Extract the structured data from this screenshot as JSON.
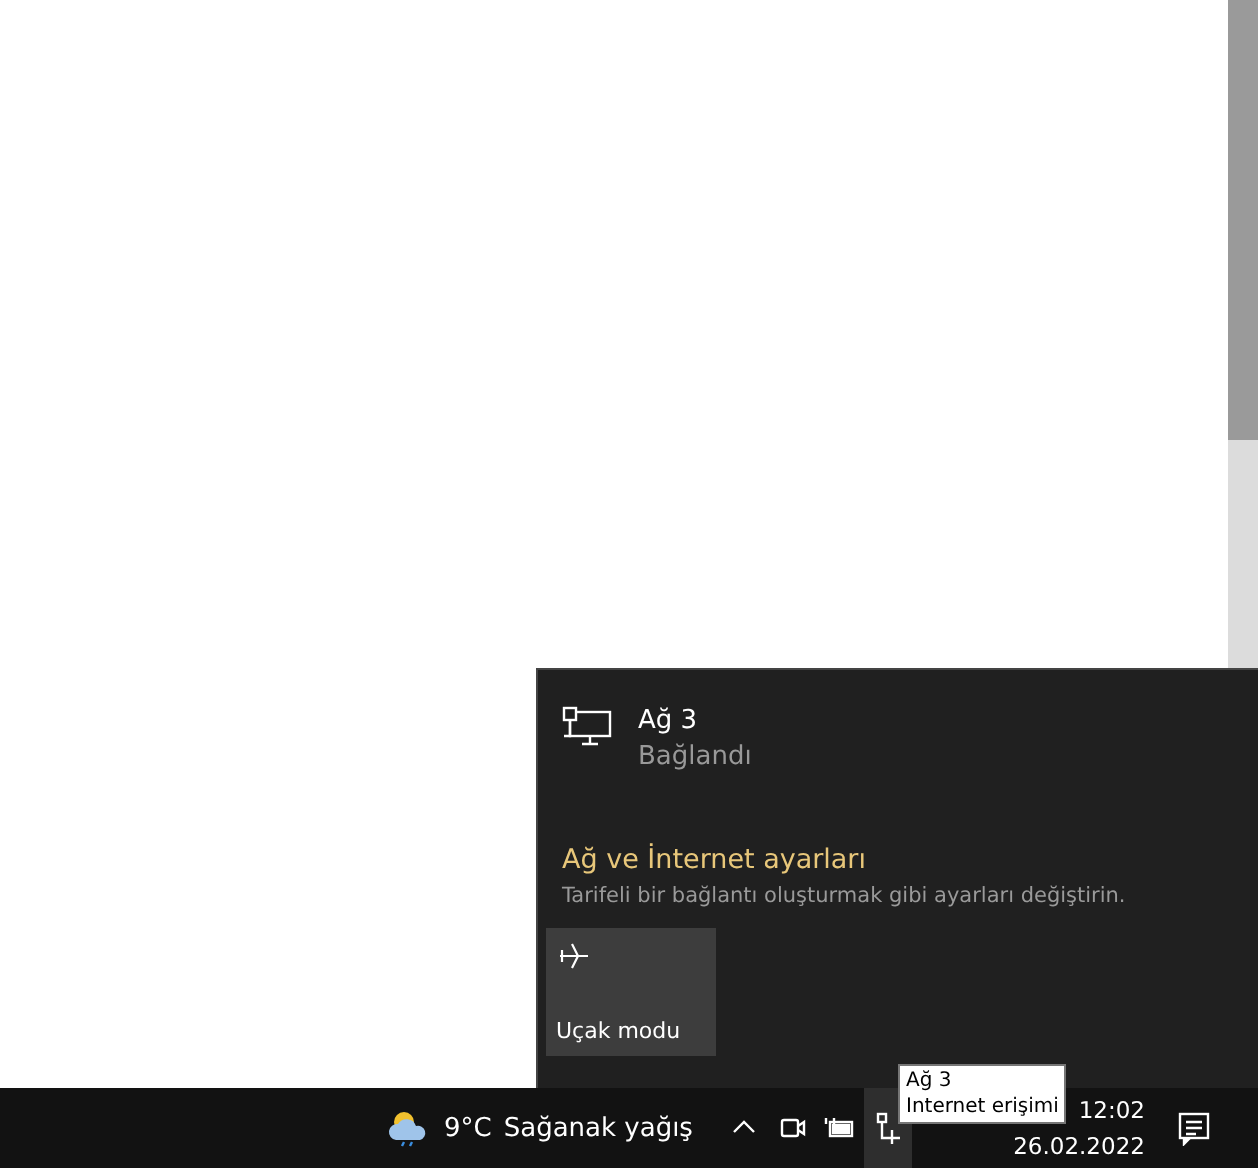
{
  "network_flyout": {
    "network": {
      "name": "Ağ 3",
      "status": "Bağlandı"
    },
    "settings_link": "Ağ ve İnternet ayarları",
    "settings_hint": "Tarifeli bir bağlantı oluşturmak gibi ayarları değiştirin.",
    "quick_actions": [
      {
        "label": "Uçak modu",
        "on": false
      }
    ]
  },
  "taskbar": {
    "weather": {
      "temperature": "9°C",
      "condition": "Sağanak yağış"
    },
    "tray_icons": [
      {
        "kind": "chevron",
        "selected": false
      },
      {
        "kind": "camera",
        "selected": false
      },
      {
        "kind": "battery",
        "selected": false
      },
      {
        "kind": "network",
        "selected": true
      }
    ],
    "clock": {
      "time": "12:02",
      "date": "26.02.2022"
    }
  },
  "tooltip": {
    "lines": [
      "Ağ 3",
      "Internet erişimi"
    ]
  }
}
